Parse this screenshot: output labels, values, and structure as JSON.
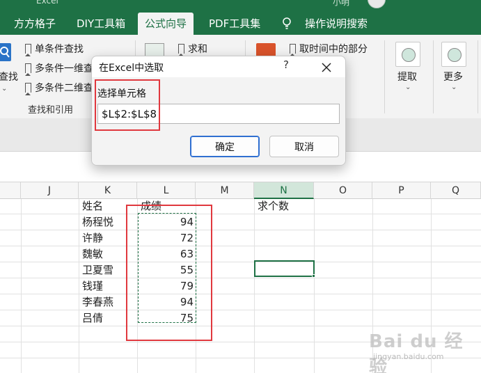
{
  "window": {
    "app_name": "Excel",
    "user": "小明"
  },
  "ribbon_tabs": [
    {
      "label": "方方格子",
      "active": false
    },
    {
      "label": "DIY工具箱",
      "active": false
    },
    {
      "label": "公式向导",
      "active": true
    },
    {
      "label": "PDF工具集",
      "active": false
    },
    {
      "label": "操作说明搜索",
      "active": false
    }
  ],
  "ribbon": {
    "find_group": {
      "partial_button": "查找",
      "items": [
        "单条件查找",
        "多条件一维查",
        "多条件二维查"
      ],
      "label": "查找和引用"
    },
    "math_group": {
      "items": [
        "求和"
      ]
    },
    "time_group": {
      "items": [
        "取时间中的部分"
      ]
    },
    "extract_button": "提取",
    "more_button": "更多"
  },
  "columns": [
    "J",
    "K",
    "L",
    "M",
    "N",
    "O",
    "P",
    "Q"
  ],
  "selected_column": "N",
  "sheet": {
    "name_header": "姓名",
    "score_header": "成绩",
    "count_header": "求个数",
    "rows": [
      {
        "name": "杨程悦",
        "score": "94"
      },
      {
        "name": "许静",
        "score": "72"
      },
      {
        "name": "魏敏",
        "score": "63"
      },
      {
        "name": "卫夏雪",
        "score": "55"
      },
      {
        "name": "钱瑾",
        "score": "79"
      },
      {
        "name": "李春燕",
        "score": "94"
      },
      {
        "name": "吕倩",
        "score": "75"
      }
    ]
  },
  "dialog": {
    "title": "在Excel中选取",
    "help": "?",
    "label": "选择单元格",
    "value": "$L$2:$L$8",
    "ok": "确定",
    "cancel": "取消"
  },
  "watermark": {
    "text": "Bai du 经验",
    "url": "jingyan.baidu.com"
  },
  "colors": {
    "excel_green": "#1e7145",
    "highlight_red": "#e0383e"
  }
}
